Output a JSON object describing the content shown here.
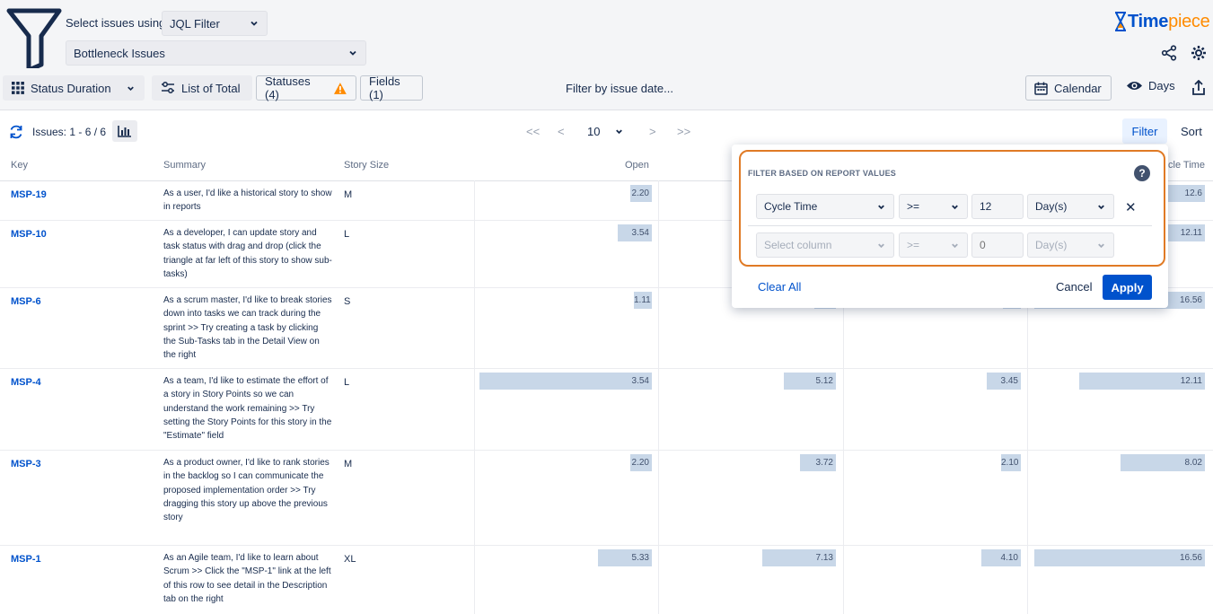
{
  "header": {
    "select_label": "Select issues using",
    "jql_dropdown": "JQL Filter",
    "filter_dropdown": "Bottleneck Issues",
    "logo": {
      "hourglass": "hourglass-icon",
      "name_bold": "Time",
      "name_light": "piece"
    }
  },
  "toolbar": {
    "status_duration": "Status Duration",
    "list_of_total": "List of Total",
    "statuses": "Statuses (4)",
    "fields": "Fields (1)",
    "filter_by_date": "Filter by issue date...",
    "calendar": "Calendar",
    "days": "Days"
  },
  "issues_bar": {
    "count": "Issues: 1 - 6 / 6",
    "page_size": "10",
    "first": "<<",
    "prev": "<",
    "next": ">",
    "last": ">>",
    "filter_tab": "Filter",
    "sort_tab": "Sort"
  },
  "table": {
    "headers": {
      "key": "Key",
      "summary": "Summary",
      "story_size": "Story Size",
      "open": "Open",
      "cycle_time": "cle Time"
    },
    "rows": [
      {
        "key": "MSP-19",
        "summary": "As a user, I'd like a historical story to show in reports",
        "size": "M",
        "values": [
          "2.20",
          "",
          "",
          "12.6"
        ],
        "bars": [
          0.12,
          0,
          0,
          0.24
        ]
      },
      {
        "key": "MSP-10",
        "summary": "As a developer, I can update story and task status with drag and drop (click the triangle at far left of this story to show sub-tasks)",
        "size": "L",
        "values": [
          "3.54",
          "",
          "",
          "12.11"
        ],
        "bars": [
          0.19,
          0,
          0,
          0.23
        ]
      },
      {
        "key": "MSP-6",
        "summary": "As a scrum master, I'd like to break stories down into tasks we can track during the sprint >> Try creating a task by clicking the Sub-Tasks tab in the Detail View on the right",
        "size": "S",
        "values": [
          "1.11",
          "",
          "",
          "16.56"
        ],
        "bars": [
          0.06,
          0.12,
          0.06,
          0.95
        ]
      },
      {
        "key": "MSP-4",
        "summary": "As a team, I'd like to estimate the effort of a story in Story Points so we can understand the work remaining >> Try setting the Story Points for this story in the \"Estimate\" field",
        "size": "L",
        "values": [
          "3.54",
          "5.12",
          "3.45",
          "12.11"
        ],
        "bars": [
          0.96,
          0.29,
          0.19,
          0.7
        ]
      },
      {
        "key": "MSP-3",
        "summary": "As a product owner, I'd like to rank stories in the backlog so I can communicate the proposed implementation order >> Try dragging this story up above the previous story",
        "size": "M",
        "values": [
          "2.20",
          "3.72",
          "2.10",
          "8.02"
        ],
        "bars": [
          0.12,
          0.2,
          0.11,
          0.47
        ]
      },
      {
        "key": "MSP-1",
        "summary": "As an Agile team, I'd like to learn about Scrum >> Click the \"MSP-1\" link at the left of this row to see detail in the Description tab on the right",
        "size": "XL",
        "values": [
          "5.33",
          "7.13",
          "4.10",
          "16.56"
        ],
        "bars": [
          0.3,
          0.41,
          0.22,
          0.95
        ]
      }
    ]
  },
  "filter_popup": {
    "title": "FILTER BASED ON REPORT VALUES",
    "help": "?",
    "row1": {
      "column": "Cycle Time",
      "operator": ">=",
      "value": "12",
      "unit": "Day(s)"
    },
    "row2": {
      "column_placeholder": "Select column",
      "operator": ">=",
      "value_placeholder": "0",
      "unit": "Day(s)"
    },
    "remove": "✕",
    "clear_all": "Clear All",
    "cancel": "Cancel",
    "apply": "Apply"
  }
}
